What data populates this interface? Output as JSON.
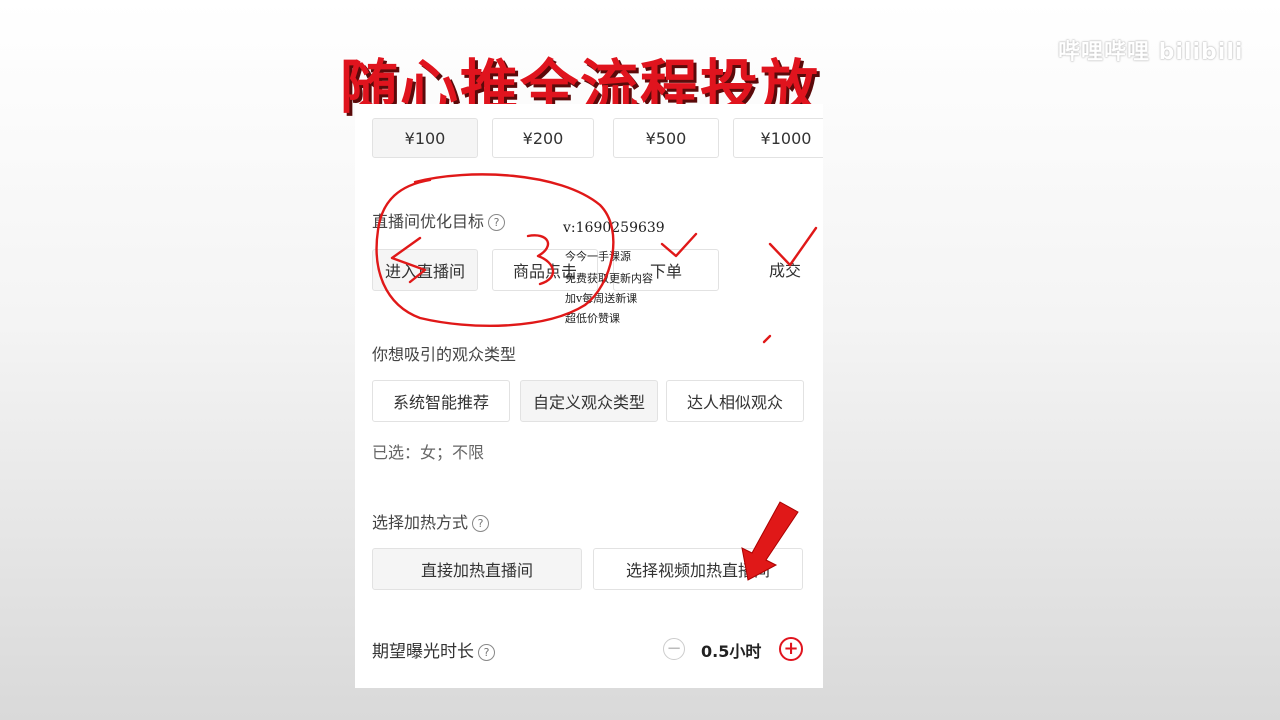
{
  "banner": {
    "title": "随心推全流程投放",
    "logo": "哔哩哔哩 bilibili"
  },
  "amounts": [
    "¥100",
    "¥200",
    "¥500",
    "¥1000"
  ],
  "goal": {
    "label": "直播间优化目标",
    "options": [
      "进入直播间",
      "商品点击",
      "下单",
      "成交"
    ]
  },
  "audience": {
    "label": "你想吸引的观众类型",
    "options": [
      "系统智能推荐",
      "自定义观众类型",
      "达人相似观众"
    ],
    "selected_text": "已选：女；不限"
  },
  "boost": {
    "label": "选择加热方式",
    "options": [
      "直接加热直播间",
      "选择视频加热直播间"
    ]
  },
  "duration": {
    "label": "期望曝光时长",
    "value": "0.5小时"
  },
  "watermark": [
    "v:1690259639",
    "今今一手课源",
    "免费获取更新内容",
    "加v每周送新课",
    "超低价赞课"
  ],
  "colors": {
    "accent": "#e0141e",
    "ink": "#e01818"
  },
  "icons": {
    "help": "question-circle-icon",
    "minus": "minus-circle-icon",
    "plus": "plus-circle-icon",
    "arrow": "red-arrow-annotation"
  }
}
